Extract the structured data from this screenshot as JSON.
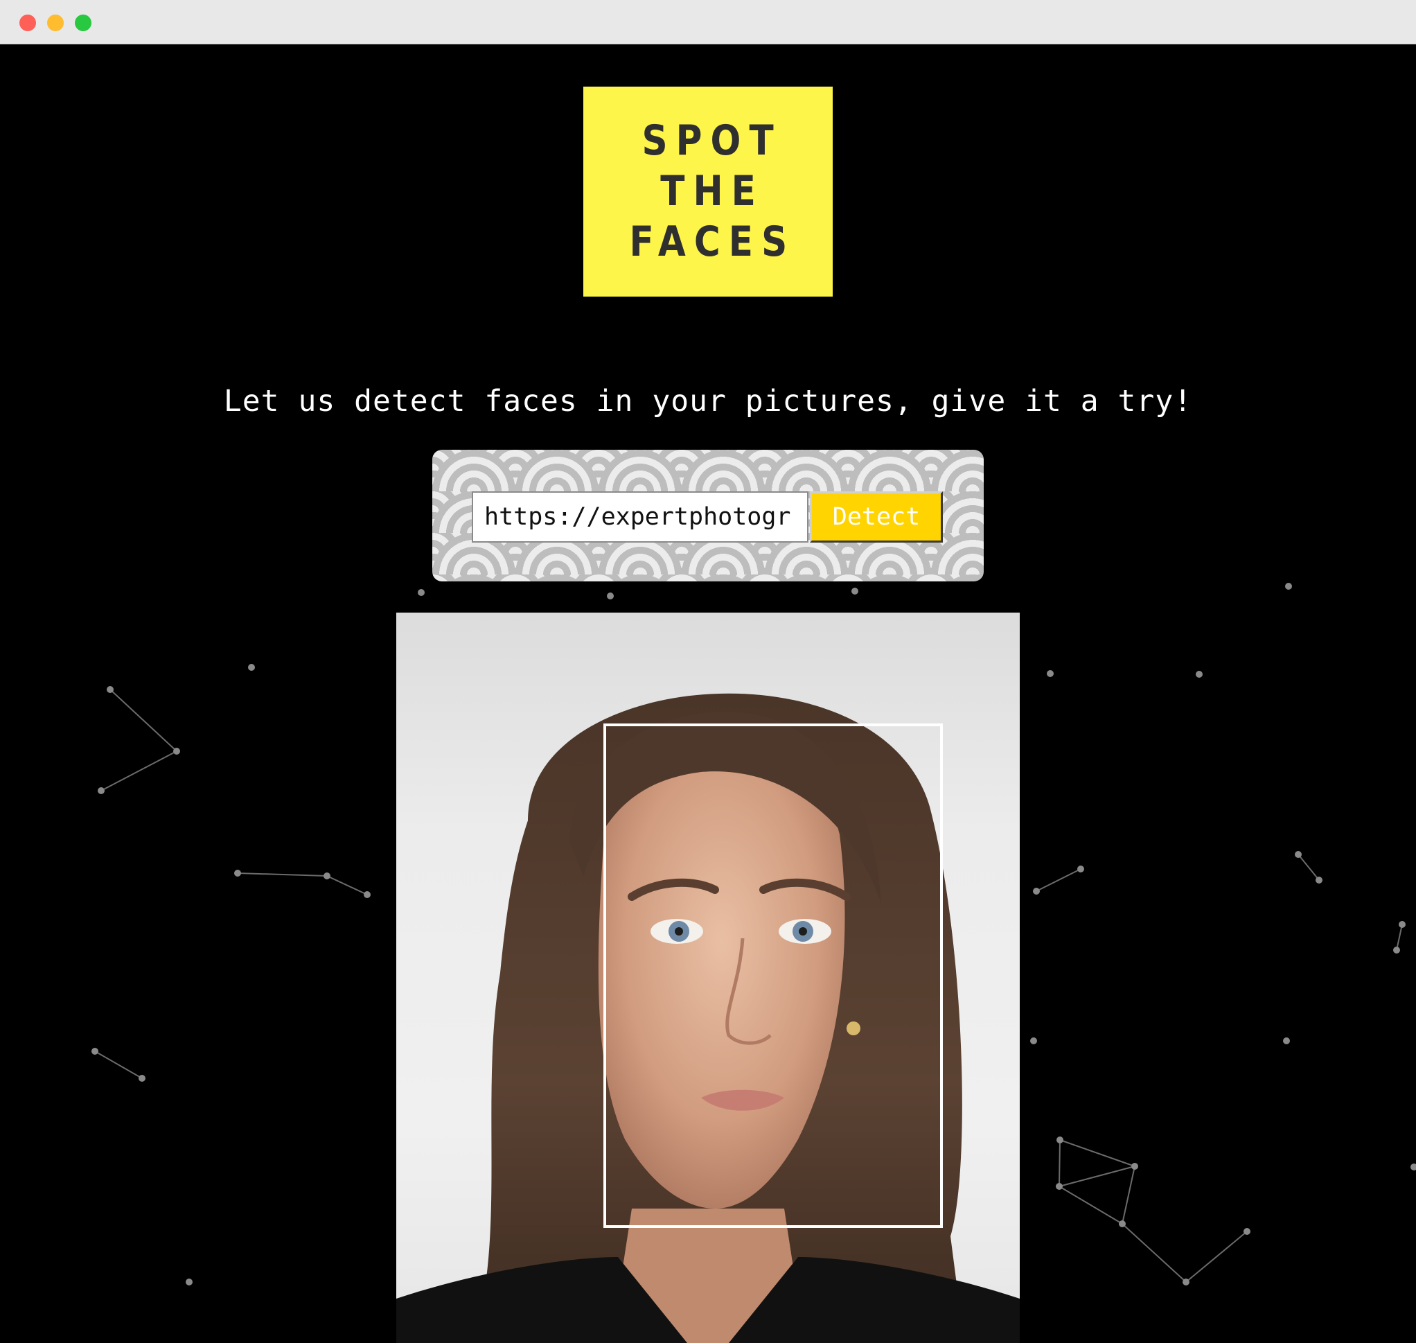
{
  "window": {
    "controls": [
      "close",
      "minimize",
      "maximize"
    ]
  },
  "logo": {
    "lines": [
      "SPOT",
      "THE",
      "FACES"
    ],
    "background_color": "#fef54a",
    "text_color": "#2f2f2f"
  },
  "tagline": "Let us detect faces in your pictures, give it a try!",
  "form": {
    "url_value": "https://expertphotogr",
    "detect_label": "Detect",
    "button_color": "#ffd400"
  },
  "result": {
    "faces_detected": 1
  }
}
